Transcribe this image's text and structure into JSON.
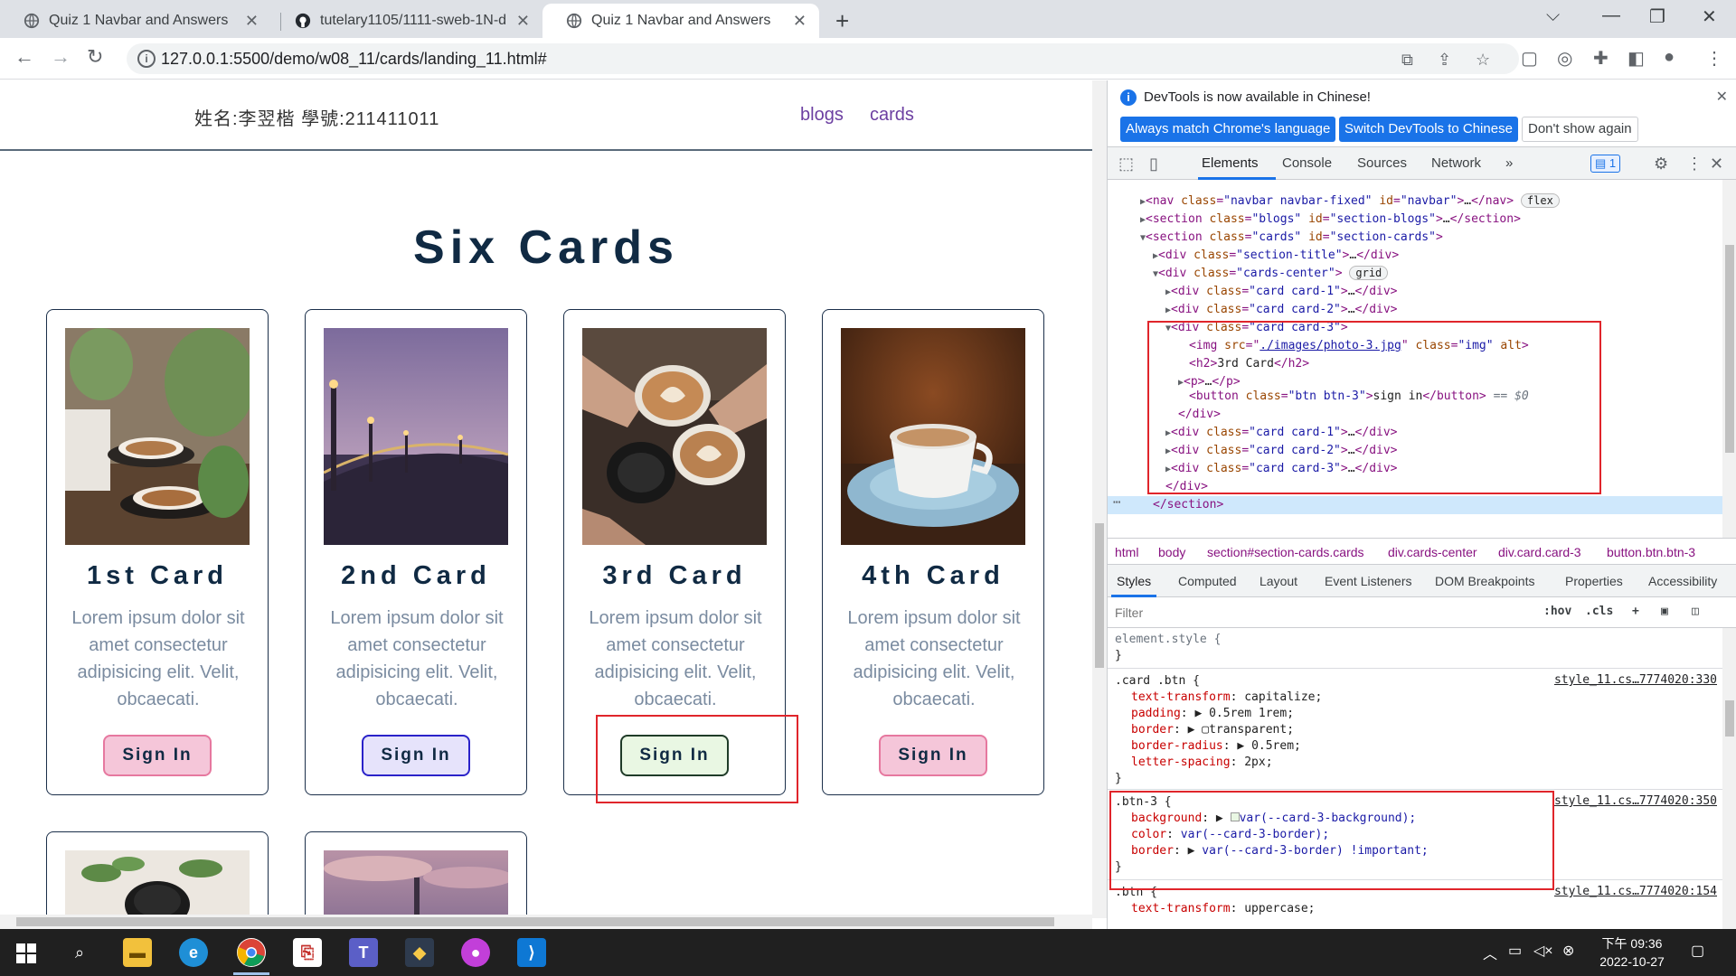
{
  "browser": {
    "tabs": [
      {
        "title": "Quiz 1 Navbar and Answers",
        "close": "✕"
      },
      {
        "title": "tutelary1105/1111-sweb-1N-d",
        "close": "✕"
      },
      {
        "title": "Quiz 1 Navbar and Answers",
        "close": "✕"
      }
    ],
    "new_tab": "+",
    "window_controls": {
      "dropdown": "⌵",
      "minimize": "—",
      "restore": "❐",
      "close": "✕"
    },
    "url": "127.0.0.1:5500/demo/w08_11/cards/landing_11.html#",
    "nav": {
      "back": "←",
      "forward": "→",
      "reload": "↻"
    }
  },
  "page": {
    "student": "姓名:李翌楷 學號:211411011",
    "links": [
      "blogs",
      "cards"
    ],
    "section_title": "Six Cards",
    "cards": [
      {
        "title": "1st Card",
        "text": "Lorem ipsum dolor sit amet consectetur adipisicing elit. Velit, obcaecati.",
        "button": "Sign In"
      },
      {
        "title": "2nd Card",
        "text": "Lorem ipsum dolor sit amet consectetur adipisicing elit. Velit, obcaecati.",
        "button": "Sign In"
      },
      {
        "title": "3rd Card",
        "text": "Lorem ipsum dolor sit amet consectetur adipisicing elit. Velit, obcaecati.",
        "button": "Sign In"
      },
      {
        "title": "4th Card",
        "text": "Lorem ipsum dolor sit amet consectetur adipisicing elit. Velit, obcaecati.",
        "button": "Sign In"
      }
    ]
  },
  "devtools": {
    "info_message": "DevTools is now available in Chinese!",
    "btn_match": "Always match Chrome's language",
    "btn_switch": "Switch DevTools to Chinese",
    "btn_dont_show": "Don't show again",
    "tabs": [
      "Elements",
      "Console",
      "Sources",
      "Network",
      "»"
    ],
    "issues_badge": "1",
    "dom": {
      "nav_tag": "nav",
      "nav_class": "\"navbar navbar-fixed\"",
      "nav_id": "\"navbar\"",
      "nav_pill": "flex",
      "blogs_class": "\"blogs\"",
      "blogs_id": "\"section-blogs\"",
      "cards_class": "\"cards\"",
      "cards_id": "\"section-cards\"",
      "title_class": "\"section-title\"",
      "center_class": "\"cards-center\"",
      "center_pill": "grid",
      "card1": "\"card card-1\"",
      "card2": "\"card card-2\"",
      "card3": "\"card card-3\"",
      "img_src": "./images/photo-3.jpg",
      "img_class": "\"img\"",
      "h2_text": "3rd Card",
      "btn_class": "\"btn btn-3\"",
      "btn_text": "sign in",
      "eq": "== $0"
    },
    "breadcrumbs": [
      "html",
      "body",
      "section#section-cards.cards",
      "div.cards-center",
      "div.card.card-3",
      "button.btn.btn-3"
    ],
    "sub_tabs": [
      "Styles",
      "Computed",
      "Layout",
      "Event Listeners",
      "DOM Breakpoints",
      "Properties",
      "Accessibility"
    ],
    "filter_placeholder": "Filter",
    "filter_tools": [
      ":hov",
      ".cls",
      "+"
    ],
    "styles": {
      "element_style": "element.style {",
      "close_brace": "}",
      "card_btn_selector": ".card .btn {",
      "card_btn_source": "style_11.cs…7774020:330",
      "card_btn_props": [
        {
          "name": "text-transform",
          "value": "capitalize;"
        },
        {
          "name": "padding",
          "value": "0.5rem 1rem;"
        },
        {
          "name": "border",
          "value": "transparent;"
        },
        {
          "name": "border-radius",
          "value": "0.5rem;"
        },
        {
          "name": "letter-spacing",
          "value": "2px;"
        }
      ],
      "btn3_selector": ".btn-3 {",
      "btn3_source": "style_11.cs…7774020:350",
      "btn3_props": [
        {
          "name": "background",
          "value": "var(--card-3-background);"
        },
        {
          "name": "color",
          "value": "var(--card-3-border);"
        },
        {
          "name": "border",
          "value": "var(--card-3-border) !important;"
        }
      ],
      "btn_selector": ".btn {",
      "btn_source": "style_11.cs…7774020:154",
      "btn_props": [
        {
          "name": "text-transform",
          "value": "uppercase;"
        }
      ]
    }
  },
  "taskbar": {
    "clock_time": "下午 09:36",
    "clock_date": "2022-10-27"
  },
  "colors": {
    "btn1_bg": "#f5c6d9",
    "btn2_bg": "#e6e3fb",
    "btn3_bg": "#e9f7e3",
    "highlight": "#e0252b",
    "link": "#6c3fa1",
    "title": "#102a43"
  }
}
